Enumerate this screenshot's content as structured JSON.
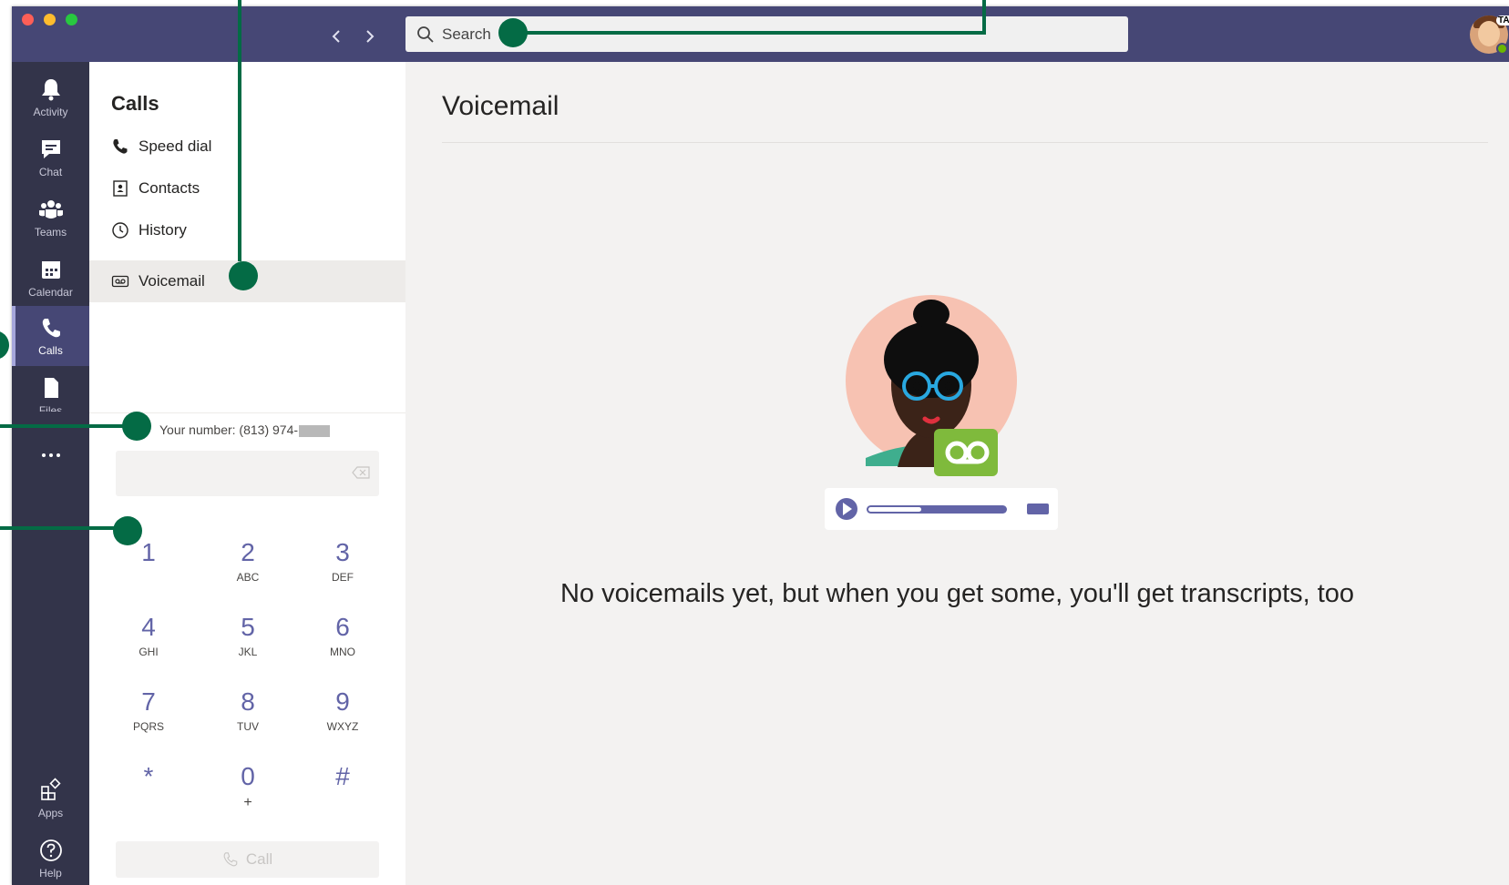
{
  "window": {
    "search_placeholder": "Search",
    "avatar_tag": "TAF"
  },
  "rail": {
    "items": [
      {
        "label": "Activity",
        "icon": "bell-icon"
      },
      {
        "label": "Chat",
        "icon": "chat-icon"
      },
      {
        "label": "Teams",
        "icon": "teams-icon"
      },
      {
        "label": "Calendar",
        "icon": "calendar-icon"
      },
      {
        "label": "Calls",
        "icon": "phone-icon",
        "active": true
      },
      {
        "label": "Files",
        "icon": "file-icon"
      },
      {
        "label": "...",
        "icon": "more-icon"
      },
      {
        "label": "Apps",
        "icon": "apps-icon"
      },
      {
        "label": "Help",
        "icon": "help-icon"
      }
    ]
  },
  "calls": {
    "title": "Calls",
    "items": [
      {
        "label": "Speed dial",
        "icon": "phone-icon"
      },
      {
        "label": "Contacts",
        "icon": "contact-card-icon"
      },
      {
        "label": "History",
        "icon": "clock-icon"
      },
      {
        "label": "Voicemail",
        "icon": "voicemail-icon",
        "active": true
      }
    ],
    "your_number_label": "Your number: (813) 974-",
    "keypad": [
      {
        "digit": "1",
        "letters": ""
      },
      {
        "digit": "2",
        "letters": "ABC"
      },
      {
        "digit": "3",
        "letters": "DEF"
      },
      {
        "digit": "4",
        "letters": "GHI"
      },
      {
        "digit": "5",
        "letters": "JKL"
      },
      {
        "digit": "6",
        "letters": "MNO"
      },
      {
        "digit": "7",
        "letters": "PQRS"
      },
      {
        "digit": "8",
        "letters": "TUV"
      },
      {
        "digit": "9",
        "letters": "WXYZ"
      },
      {
        "digit": "*",
        "letters": ""
      },
      {
        "digit": "0",
        "letters": "+"
      },
      {
        "digit": "#",
        "letters": ""
      }
    ],
    "call_button_label": "Call"
  },
  "main": {
    "title": "Voicemail",
    "empty_message": "No voicemails yet, but when you get some, you'll get transcripts, too"
  },
  "colors": {
    "titlebar": "#464775",
    "rail": "#33344a",
    "accent": "#6264a7",
    "callout": "#046b45",
    "voicemail_badge": "#7fba3c"
  }
}
